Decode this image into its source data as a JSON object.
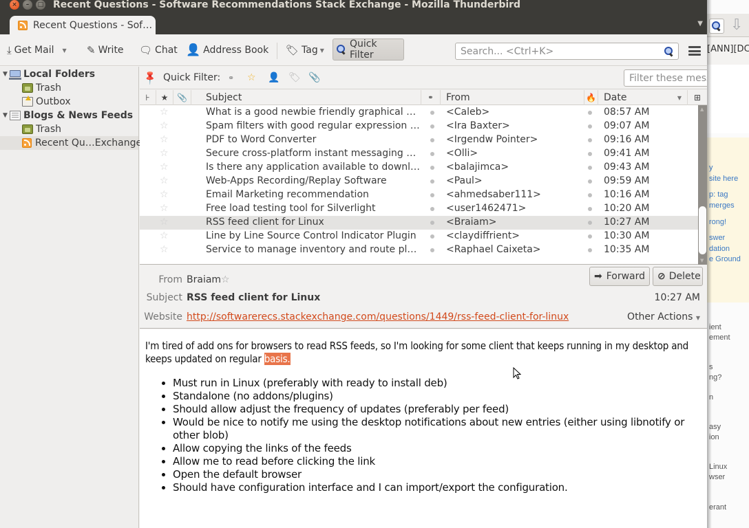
{
  "window": {
    "title": "Recent Questions - Software Recommendations Stack Exchange - Mozilla Thunderbird",
    "buttons": [
      "close",
      "minimize",
      "maximize"
    ]
  },
  "tab": {
    "label": "Recent Questions - Sof…",
    "icon": "rss-feed-icon"
  },
  "toolbar": {
    "get_mail": "Get Mail",
    "write": "Write",
    "chat": "Chat",
    "address_book": "Address Book",
    "tag": "Tag",
    "quick_filter": "Quick Filter",
    "search_placeholder": "Search... <Ctrl+K>"
  },
  "folders": [
    {
      "label": "Local Folders",
      "icon": "computer-icon",
      "bold": true,
      "expanded": true
    },
    {
      "label": "Trash",
      "icon": "trash-icon"
    },
    {
      "label": "Outbox",
      "icon": "outbox-icon"
    },
    {
      "label": "Blogs & News Feeds",
      "icon": "feeds-icon",
      "bold": true,
      "expanded": true
    },
    {
      "label": "Trash",
      "icon": "trash-icon"
    },
    {
      "label": "Recent Qu…Exchange",
      "icon": "rss-feed-icon",
      "selected": true
    }
  ],
  "quick_filter": {
    "label": "Quick Filter:",
    "filter_placeholder": "Filter these messages... <Ctrl+Shift+K>",
    "icons": [
      "unread-icon",
      "starred-icon",
      "contact-icon",
      "tag-icon",
      "attachment-icon"
    ]
  },
  "columns": {
    "thread": "thread-icon",
    "starred": "star-icon",
    "attachment": "attachment-icon",
    "subject": "Subject",
    "read": "read-status-icon",
    "from": "From",
    "junk": "junk-icon",
    "date": "Date",
    "picker": "column-picker-icon"
  },
  "messages": [
    {
      "subject": "What is a good newbie friendly graphical git …",
      "from": "<Caleb>",
      "date": "08:57 AM"
    },
    {
      "subject": "Spam filters with good regular expression su…",
      "from": "<Ira Baxter>",
      "date": "09:07 AM"
    },
    {
      "subject": "PDF to Word Converter",
      "from": "<Irgendw Pointer>",
      "date": "09:16 AM"
    },
    {
      "subject": "Secure cross-platform instant messaging sof…",
      "from": "<Olli>",
      "date": "09:41 AM"
    },
    {
      "subject": "Is there any application available to downloa…",
      "from": "<balajimca>",
      "date": "09:43 AM"
    },
    {
      "subject": "Web-Apps Recording/Replay Software",
      "from": "<Paul>",
      "date": "09:59 AM"
    },
    {
      "subject": "Email Marketing recommendation",
      "from": "<ahmedsaber111>",
      "date": "10:16 AM"
    },
    {
      "subject": "Free load testing tool for Silverlight",
      "from": "<user1462471>",
      "date": "10:20 AM"
    },
    {
      "subject": "RSS feed client for Linux",
      "from": "<Braiam>",
      "date": "10:27 AM",
      "selected": true
    },
    {
      "subject": "Line by Line Source Control Indicator Plugin",
      "from": "<claydiffrient>",
      "date": "10:30 AM"
    },
    {
      "subject": "Service to manage inventory and route plann…",
      "from": "<Raphael Caixeta>",
      "date": "10:35 AM"
    }
  ],
  "header": {
    "from_label": "From",
    "from_value": "Braiam",
    "subject_label": "Subject",
    "subject_value": "RSS feed client for Linux",
    "website_label": "Website",
    "website_value": "http://softwarerecs.stackexchange.com/questions/1449/rss-feed-client-for-linux",
    "time": "10:27 AM",
    "forward": "Forward",
    "delete": "Delete",
    "other_actions": "Other Actions"
  },
  "body": {
    "intro": "I'm tired of add ons for browsers to read RSS feeds, so I'm looking for some client that keeps running in my desktop and keeps updated on regular ",
    "highlight": "basis.",
    "items": [
      "Must run in Linux (preferably with ready to install deb)",
      "Standalone (no addons/plugins)",
      "Should allow adjust the frequency of updates (preferably per feed)",
      "Would be nice to notify me using the desktop notifications about new entries (either using libnotify or other blob)",
      "Allow copying the links of the feeds",
      "Allow me to read before clicking the link",
      "Open the default browser",
      "Should have configuration interface and I can import/export the configuration."
    ]
  },
  "background_window": {
    "text_top": "[ANN][DC",
    "yellow_links": [
      "y",
      "site here",
      "p: tag",
      "merges",
      "rong!",
      "swer",
      "dation",
      "e Ground"
    ],
    "grey_texts": [
      "ient",
      "ement",
      "s",
      "ng?",
      "n",
      "asy",
      "ion",
      "Linux",
      "wser",
      "erant"
    ]
  },
  "colors": {
    "accent_orange": "#dd4814",
    "link": "#d24a1c",
    "highlight": "#e8744a",
    "titlebar": "#3c3b37"
  }
}
